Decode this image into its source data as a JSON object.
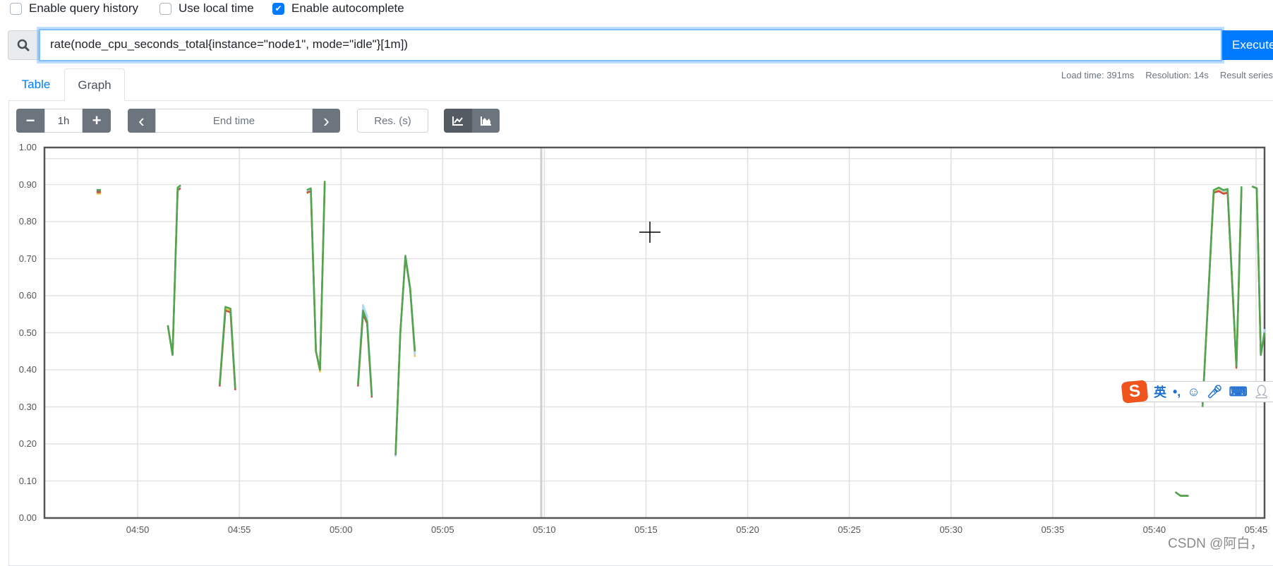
{
  "options": [
    {
      "label": "Enable query history",
      "checked": false
    },
    {
      "label": "Use local time",
      "checked": false
    },
    {
      "label": "Enable autocomplete",
      "checked": true
    }
  ],
  "query": {
    "value": "rate(node_cpu_seconds_total{instance=\"node1\", mode=\"idle\"}[1m])",
    "execute_label": "Execute",
    "icon": "search-icon"
  },
  "tabs": [
    {
      "label": "Table",
      "active": false
    },
    {
      "label": "Graph",
      "active": true
    }
  ],
  "stats": {
    "load_time": "Load time: 391ms",
    "resolution": "Resolution: 14s",
    "result_series": "Result series"
  },
  "controls": {
    "range_minus": "−",
    "range": "1h",
    "range_plus": "+",
    "prev": "‹",
    "end_time_placeholder": "End time",
    "next": "›",
    "resolution_placeholder": "Res. (s)",
    "line_icon": "line-chart-icon",
    "stacked_icon": "stacked-chart-icon"
  },
  "ime": {
    "label": "英",
    "punct": "•,"
  },
  "watermark": "CSDN @阿白，",
  "chart_data": {
    "type": "line",
    "xlim": [
      "04:45:25",
      "05:45:25"
    ],
    "ylim": [
      0,
      1
    ],
    "yticks": [
      "0.00",
      "0.10",
      "0.20",
      "0.30",
      "0.40",
      "0.50",
      "0.60",
      "0.70",
      "0.80",
      "0.90",
      "1.00"
    ],
    "xticks": [
      "04:50",
      "04:55",
      "05:00",
      "05:05",
      "05:10",
      "05:15",
      "05:20",
      "05:25",
      "05:30",
      "05:35",
      "05:40",
      "05:45"
    ],
    "grid": true,
    "series": [
      {
        "color": "#edc240",
        "points": [
          [
            "04:48:05",
            0.876
          ],
          null,
          [
            "04:51:29",
            0.52
          ],
          [
            "04:51:43",
            0.44
          ],
          [
            "04:51:58",
            0.89
          ],
          [
            "04:52:07",
            0.895
          ],
          null,
          [
            "04:54:02",
            0.36
          ],
          [
            "04:54:19",
            0.565
          ],
          [
            "04:54:34",
            0.56
          ],
          [
            "04:54:48",
            0.35
          ],
          null,
          [
            "04:58:19",
            0.876
          ],
          [
            "04:58:31",
            0.885
          ],
          [
            "04:58:46",
            0.45
          ],
          [
            "04:58:58",
            0.395
          ],
          [
            "04:59:12",
            0.905
          ],
          null,
          [
            "05:00:50",
            0.36
          ],
          [
            "05:01:05",
            0.56
          ],
          [
            "05:01:17",
            0.53
          ],
          [
            "05:01:31",
            0.33
          ],
          null,
          [
            "05:02:41",
            0.17
          ],
          [
            "05:02:55",
            0.5
          ],
          [
            "05:03:10",
            0.705
          ],
          [
            "05:03:24",
            0.62
          ],
          [
            "05:03:38",
            0.435
          ],
          null,
          [
            "05:41:02",
            0.07
          ],
          [
            "05:41:17",
            0.06
          ],
          [
            "05:41:41",
            0.06
          ],
          null,
          [
            "05:42:22",
            0.3
          ],
          [
            "05:42:55",
            0.88
          ],
          [
            "05:43:10",
            0.885
          ],
          [
            "05:43:24",
            0.878
          ],
          [
            "05:43:36",
            0.882
          ],
          [
            "05:44:02",
            0.41
          ],
          [
            "05:44:17",
            0.89
          ],
          null,
          [
            "05:44:48",
            0.895
          ],
          [
            "05:45:02",
            0.89
          ],
          [
            "05:45:14",
            0.44
          ],
          [
            "05:45:25",
            0.5
          ]
        ]
      },
      {
        "color": "#afd8f8",
        "points": [
          [
            "04:48:05",
            0.882
          ],
          null,
          [
            "04:51:29",
            0.52
          ],
          [
            "04:51:43",
            0.44
          ],
          [
            "04:51:58",
            0.89
          ],
          [
            "04:52:07",
            0.895
          ],
          null,
          [
            "04:54:02",
            0.36
          ],
          [
            "04:54:19",
            0.57
          ],
          [
            "04:54:34",
            0.565
          ],
          [
            "04:54:48",
            0.35
          ],
          null,
          [
            "04:58:19",
            0.88
          ],
          [
            "04:58:31",
            0.888
          ],
          [
            "04:58:46",
            0.45
          ],
          [
            "04:58:58",
            0.4
          ],
          [
            "04:59:12",
            0.905
          ],
          null,
          [
            "05:00:50",
            0.36
          ],
          [
            "05:01:05",
            0.575
          ],
          [
            "05:01:17",
            0.545
          ],
          [
            "05:01:31",
            0.33
          ],
          null,
          [
            "05:02:41",
            0.165
          ],
          [
            "05:02:55",
            0.5
          ],
          [
            "05:03:10",
            0.7
          ],
          [
            "05:03:24",
            0.615
          ],
          [
            "05:03:38",
            0.44
          ],
          null,
          [
            "05:41:02",
            0.07
          ],
          [
            "05:41:17",
            0.06
          ],
          [
            "05:41:41",
            0.06
          ],
          null,
          [
            "05:42:22",
            0.3
          ],
          [
            "05:42:55",
            0.885
          ],
          [
            "05:43:10",
            0.89
          ],
          [
            "05:43:24",
            0.882
          ],
          [
            "05:43:36",
            0.885
          ],
          [
            "05:44:02",
            0.41
          ],
          [
            "05:44:17",
            0.895
          ],
          null,
          [
            "05:44:48",
            0.895
          ],
          [
            "05:45:02",
            0.89
          ],
          [
            "05:45:14",
            0.44
          ],
          [
            "05:45:25",
            0.51
          ]
        ]
      },
      {
        "color": "#cb4b4b",
        "points": [
          [
            "04:48:05",
            0.88
          ],
          null,
          [
            "04:51:29",
            0.52
          ],
          [
            "04:51:43",
            0.44
          ],
          [
            "04:51:58",
            0.885
          ],
          [
            "04:52:07",
            0.89
          ],
          null,
          [
            "04:54:02",
            0.355
          ],
          [
            "04:54:19",
            0.56
          ],
          [
            "04:54:34",
            0.555
          ],
          [
            "04:54:48",
            0.345
          ],
          null,
          [
            "04:58:19",
            0.878
          ],
          [
            "04:58:31",
            0.882
          ],
          [
            "04:58:46",
            0.45
          ],
          [
            "04:58:58",
            0.4
          ],
          [
            "04:59:12",
            0.905
          ],
          null,
          [
            "05:00:50",
            0.355
          ],
          [
            "05:01:05",
            0.55
          ],
          [
            "05:01:17",
            0.525
          ],
          [
            "05:01:31",
            0.325
          ],
          null,
          [
            "05:02:41",
            0.17
          ],
          [
            "05:02:55",
            0.5
          ],
          [
            "05:03:10",
            0.705
          ],
          [
            "05:03:24",
            0.62
          ],
          [
            "05:03:38",
            0.45
          ],
          null,
          [
            "05:41:02",
            0.07
          ],
          [
            "05:41:17",
            0.06
          ],
          [
            "05:41:41",
            0.06
          ],
          null,
          [
            "05:42:22",
            0.3
          ],
          [
            "05:42:55",
            0.878
          ],
          [
            "05:43:10",
            0.882
          ],
          [
            "05:43:24",
            0.875
          ],
          [
            "05:43:36",
            0.878
          ],
          [
            "05:44:02",
            0.405
          ],
          [
            "05:44:17",
            0.885
          ],
          null,
          [
            "05:44:48",
            0.895
          ],
          [
            "05:45:02",
            0.89
          ],
          [
            "05:45:14",
            0.44
          ],
          [
            "05:45:25",
            0.5
          ]
        ]
      },
      {
        "color": "#4da74d",
        "points": [
          [
            "04:48:05",
            0.885
          ],
          null,
          [
            "04:51:29",
            0.52
          ],
          [
            "04:51:43",
            0.44
          ],
          [
            "04:51:58",
            0.892
          ],
          [
            "04:52:07",
            0.898
          ],
          null,
          [
            "04:54:02",
            0.36
          ],
          [
            "04:54:19",
            0.57
          ],
          [
            "04:54:34",
            0.565
          ],
          [
            "04:54:48",
            0.35
          ],
          null,
          [
            "04:58:19",
            0.885
          ],
          [
            "04:58:31",
            0.89
          ],
          [
            "04:58:46",
            0.45
          ],
          [
            "04:58:58",
            0.4
          ],
          [
            "04:59:12",
            0.91
          ],
          null,
          [
            "05:00:50",
            0.36
          ],
          [
            "05:01:05",
            0.56
          ],
          [
            "05:01:17",
            0.53
          ],
          [
            "05:01:31",
            0.33
          ],
          null,
          [
            "05:02:41",
            0.17
          ],
          [
            "05:02:55",
            0.5
          ],
          [
            "05:03:10",
            0.708
          ],
          [
            "05:03:24",
            0.62
          ],
          [
            "05:03:38",
            0.45
          ],
          null,
          [
            "05:41:02",
            0.07
          ],
          [
            "05:41:17",
            0.06
          ],
          [
            "05:41:41",
            0.06
          ],
          null,
          [
            "05:42:22",
            0.3
          ],
          [
            "05:42:55",
            0.885
          ],
          [
            "05:43:10",
            0.892
          ],
          [
            "05:43:24",
            0.885
          ],
          [
            "05:43:36",
            0.888
          ],
          [
            "05:44:02",
            0.41
          ],
          [
            "05:44:17",
            0.895
          ],
          null,
          [
            "05:44:48",
            0.895
          ],
          [
            "05:45:02",
            0.89
          ],
          [
            "05:45:14",
            0.44
          ],
          [
            "05:45:25",
            0.5
          ]
        ]
      }
    ]
  }
}
